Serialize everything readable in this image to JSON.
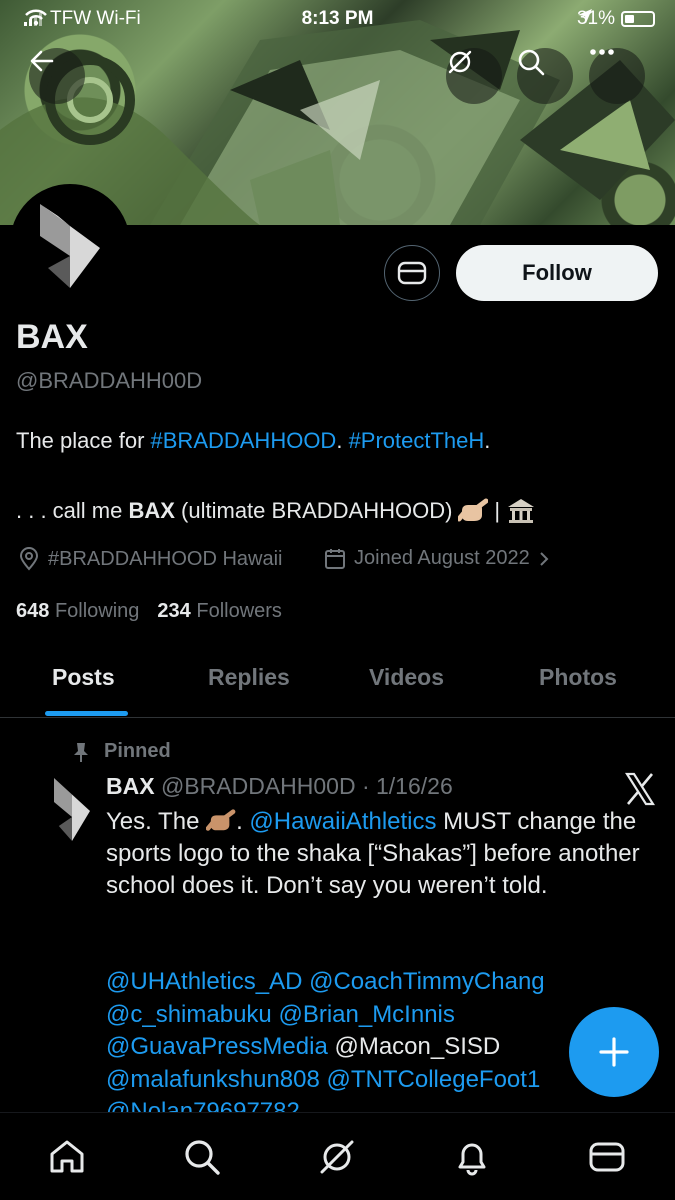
{
  "status_bar": {
    "carrier": "TFW Wi-Fi",
    "time": "8:13 PM",
    "battery": "31%"
  },
  "profile": {
    "name": "BAX",
    "handle": "@BRADDAHH00D",
    "follow_label": "Follow",
    "bio_line1_prefix": "The place for ",
    "bio_tag1": "#BRADDAHHOOD",
    "bio_sep": ". ",
    "bio_tag2": "#ProtectTheH",
    "bio_end": ".",
    "bio_line2_prefix": ". . . call me ",
    "bio_line2_bold": "BAX",
    "bio_line2_suffix": " (ultimate BRADDAHHOOD)",
    "bio_line2_divider": "|",
    "location": "#BRADDAHHOOD Hawaii",
    "joined": "Joined August 2022",
    "following_count": "648",
    "following_label": "Following",
    "followers_count": "234",
    "followers_label": "Followers"
  },
  "tabs": [
    {
      "label": "Posts",
      "active": true
    },
    {
      "label": "Replies",
      "active": false
    },
    {
      "label": "Videos",
      "active": false
    },
    {
      "label": "Photos",
      "active": false
    }
  ],
  "post": {
    "pinned_label": "Pinned",
    "author": "BAX",
    "handle_date": "@BRADDAHH00D · 1/16/26",
    "text_1a": "Yes. The ",
    "text_1b": ". ",
    "text_mention": "@HawaiiAthletics",
    "text_1c": " MUST change the sports logo to the shaka [“Shakas”] before another school does it. Don’t say you weren’t told.",
    "mentions": [
      {
        "text": "@UHAthletics_AD",
        "link": true
      },
      {
        "text": "@CoachTimmyChang",
        "link": true
      },
      {
        "text": "@c_shimabuku",
        "link": true
      },
      {
        "text": "@Brian_McInnis",
        "link": true
      },
      {
        "text": "@GuavaPressMedia",
        "link": true
      },
      {
        "text": "@Macon_SISD",
        "link": false
      },
      {
        "text": "@malafunkshun808",
        "link": true
      },
      {
        "text": "@TNTCollegeFoot1",
        "link": true
      },
      {
        "text": "@Nolan79697782",
        "link": true
      }
    ]
  },
  "colors": {
    "accent": "#1d9bf0",
    "muted": "#71767b",
    "text": "#e7e9ea",
    "background": "#000000"
  },
  "icons": [
    "back-arrow-icon",
    "grok-icon",
    "search-icon",
    "more-icon",
    "message-icon",
    "location-icon",
    "calendar-icon",
    "chevron-right-icon",
    "pin-icon",
    "x-logo-icon",
    "compose-plus-icon",
    "home-icon",
    "notifications-icon",
    "mail-icon",
    "shaka-emoji",
    "bank-emoji"
  ]
}
